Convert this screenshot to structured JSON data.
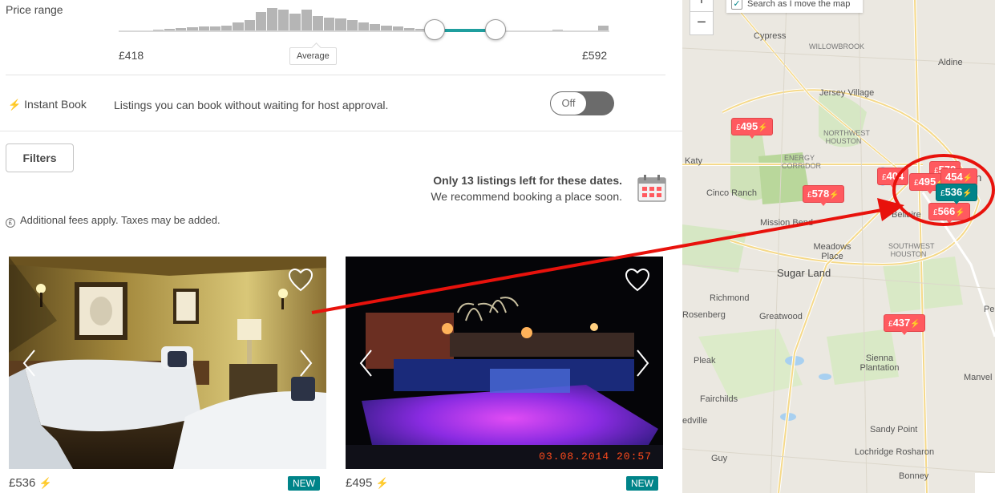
{
  "filters": {
    "price_range_label": "Price range",
    "price_min": "£418",
    "price_max": "£592",
    "average_label": "Average",
    "histogram": [
      1,
      2,
      3,
      4,
      5,
      6,
      7,
      8,
      9,
      10,
      14,
      18,
      30,
      36,
      34,
      28,
      34,
      24,
      22,
      20,
      18,
      14,
      12,
      10,
      8,
      6,
      5,
      4,
      3,
      3,
      2,
      2,
      3,
      1,
      0,
      2,
      3,
      2,
      4,
      3,
      2,
      3,
      10
    ],
    "selected_range": [
      0.645,
      0.77
    ],
    "instant_book_label": "Instant Book",
    "instant_book_desc": "Listings you can book without waiting for host approval.",
    "instant_book_state": "Off",
    "filters_button": "Filters"
  },
  "notice": {
    "title": "Only 13 listings left for these dates.",
    "subtitle": "We recommend booking a place soon."
  },
  "fees_note": "Additional fees apply. Taxes may be added.",
  "listings": [
    {
      "price": "£536",
      "badge": "NEW",
      "photo": "bedroom"
    },
    {
      "price": "£495",
      "badge": "NEW",
      "photo": "pool",
      "photo_stamp": "03.08.2014  20:57"
    }
  ],
  "map": {
    "search_as_move": "Search as I move the map",
    "zoom_in": "+",
    "zoom_out": "−",
    "cities": [
      {
        "name": "Cypress",
        "size": "normal"
      },
      {
        "name": "WILLOWBROOK",
        "size": "small"
      },
      {
        "name": "Aldine",
        "size": "normal"
      },
      {
        "name": "Jersey Village",
        "size": "normal"
      },
      {
        "name": "NORTHWEST HOUSTON",
        "size": "small"
      },
      {
        "name": "Katy",
        "size": "normal"
      },
      {
        "name": "ENERGY CORRIDOR",
        "size": "small"
      },
      {
        "name": "Cinco Ranch",
        "size": "normal"
      },
      {
        "name": "Mission Bend",
        "size": "normal"
      },
      {
        "name": "Bellaire",
        "size": "normal"
      },
      {
        "name": "Meadows Place",
        "size": "normal"
      },
      {
        "name": "SOUTHWEST HOUSTON",
        "size": "small"
      },
      {
        "name": "Sugar Land",
        "size": "big"
      },
      {
        "name": "Richmond",
        "size": "normal"
      },
      {
        "name": "Rosenberg",
        "size": "normal"
      },
      {
        "name": "Greatwood",
        "size": "normal"
      },
      {
        "name": "Pleak",
        "size": "normal"
      },
      {
        "name": "Sienna Plantation",
        "size": "normal"
      },
      {
        "name": "Manvel",
        "size": "normal"
      },
      {
        "name": "Fairchilds",
        "size": "normal"
      },
      {
        "name": "edville",
        "size": "normal"
      },
      {
        "name": "Sandy Point",
        "size": "normal"
      },
      {
        "name": "Lochridge Rosharon",
        "size": "normal"
      },
      {
        "name": "Guy",
        "size": "normal"
      },
      {
        "name": "Bonney",
        "size": "normal"
      },
      {
        "name": "Pe",
        "size": "normal"
      },
      {
        "name": "n",
        "size": "big"
      }
    ],
    "pins": [
      {
        "price": "495",
        "selected": false
      },
      {
        "price": "578",
        "selected": false
      },
      {
        "price": "437",
        "selected": false
      },
      {
        "price": "454",
        "selected": false
      },
      {
        "price": "495",
        "selected": false
      },
      {
        "price": "536",
        "selected": true
      },
      {
        "price": "566",
        "selected": false
      },
      {
        "price": "404",
        "selected": false
      },
      {
        "price": "578",
        "selected": false
      }
    ],
    "currency": "£"
  },
  "colors": {
    "accent": "#008489",
    "pin": "#ff5a5f",
    "annotation": "#e8120c"
  }
}
